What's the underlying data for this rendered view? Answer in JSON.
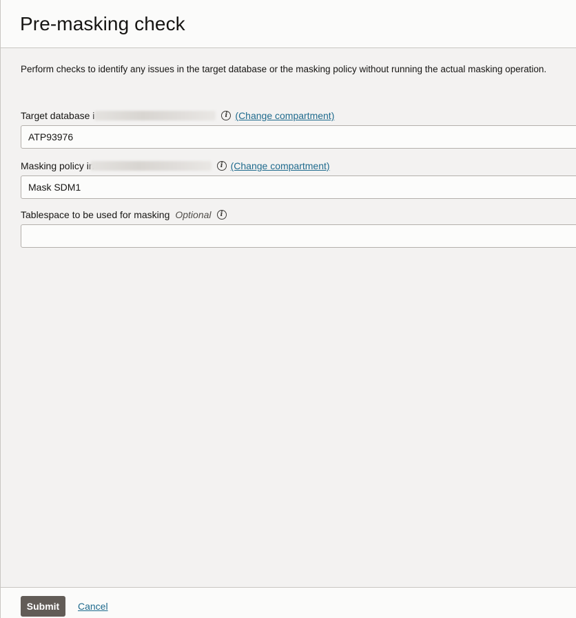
{
  "header": {
    "title": "Pre-masking check"
  },
  "description": "Perform checks to identify any issues in the target database or the masking policy without running the actual masking operation.",
  "fields": {
    "target_database": {
      "label": "Target database i",
      "change_link": "(Change compartment)",
      "value": "ATP93976"
    },
    "masking_policy": {
      "label": "Masking policy in",
      "change_link": "(Change compartment)",
      "value": "Mask SDM1"
    },
    "tablespace": {
      "label": "Tablespace to be used for masking",
      "optional": "Optional",
      "value": ""
    }
  },
  "footer": {
    "submit_label": "Submit",
    "cancel_label": "Cancel"
  },
  "icons": {
    "info": "info-icon"
  },
  "colors": {
    "link": "#1e6a8d",
    "submit_bg": "#625c57",
    "panel_bg": "#f3f2f1"
  }
}
